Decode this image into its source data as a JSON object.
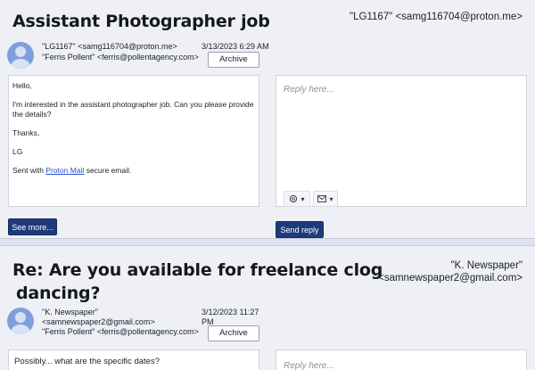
{
  "emails": [
    {
      "subject": "Assistant Photographer job",
      "from_header": "\"LG1167\" <samg116704@proton.me>",
      "from_line": "\"LG1167\" <samg116704@proton.me>",
      "to_line": "\"Ferris Pollent\" <ferris@pollentagency.com>",
      "date": "3/13/2023 6:29 AM",
      "archive_label": "Archive",
      "body": {
        "greeting": "Hello,",
        "text": "I'm interested in the assistant photographer job. Can you please provide the details?",
        "thanks": "Thanks,",
        "signature": "LG",
        "sent_prefix": "Sent with ",
        "sent_link": "Proton Mail",
        "sent_suffix": " secure email."
      },
      "see_more_label": "See more...",
      "reply_placeholder": "Reply here...",
      "send_reply_label": "Send reply"
    },
    {
      "subject_line1": "Re: Are you available for freelance clog",
      "subject_line2": "dancing?",
      "from_header_line1": "\"K. Newspaper\"",
      "from_header_line2": "<samnewspaper2@gmail.com>",
      "from_line1": "\"K. Newspaper\"",
      "from_line2": "<samnewspaper2@gmail.com>",
      "to_line": "\"Ferris Pollent\" <ferris@pollentagency.com>",
      "date_line1": "3/12/2023 11:27",
      "date_line2": "PM",
      "archive_label": "Archive",
      "body_text": "Possibly... what are the specific dates?",
      "reply_placeholder": "Reply here..."
    }
  ],
  "icons": {
    "ai": "openai-icon",
    "template": "mail-icon",
    "caret": "chevron-down-icon"
  }
}
